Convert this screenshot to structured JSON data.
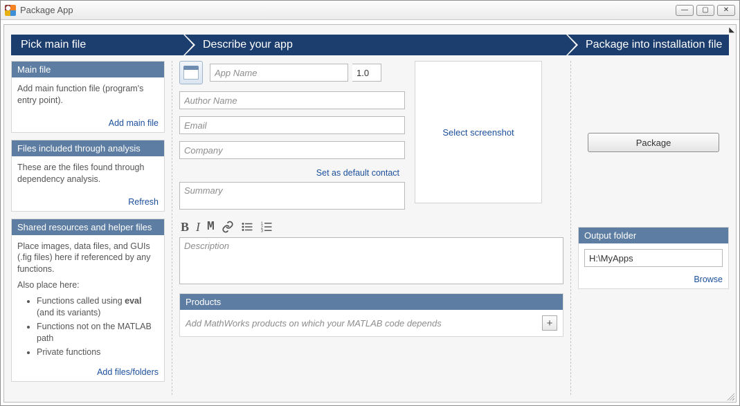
{
  "window": {
    "title": "Package App"
  },
  "steps": {
    "s1": "Pick main file",
    "s2": "Describe your app",
    "s3": "Package into installation file"
  },
  "left": {
    "mainfile": {
      "hdr": "Main file",
      "body": "Add main function file (program's entry point).",
      "link": "Add main file"
    },
    "included": {
      "hdr": "Files included through analysis",
      "body": "These are the files found through dependency analysis.",
      "link": "Refresh"
    },
    "shared": {
      "hdr": "Shared resources and helper files",
      "body1": "Place images, data files, and GUIs (.fig files) here if referenced by any functions.",
      "body2": "Also place here:",
      "li1a": "Functions called using ",
      "li1b": "eval",
      "li1c": " (and its variants)",
      "li2": "Functions not on the MATLAB path",
      "li3": "Private functions",
      "link": "Add files/folders"
    }
  },
  "mid": {
    "appname_ph": "App Name",
    "version": "1.0",
    "author_ph": "Author Name",
    "email_ph": "Email",
    "company_ph": "Company",
    "setdefault": "Set as default contact",
    "summary_ph": "Summary",
    "desc_ph": "Description",
    "screenshot": "Select screenshot",
    "products": {
      "hdr": "Products",
      "ph": "Add MathWorks products on which your MATLAB code depends"
    }
  },
  "right": {
    "package": "Package",
    "output": {
      "hdr": "Output folder",
      "value": "H:\\MyApps",
      "browse": "Browse"
    }
  }
}
